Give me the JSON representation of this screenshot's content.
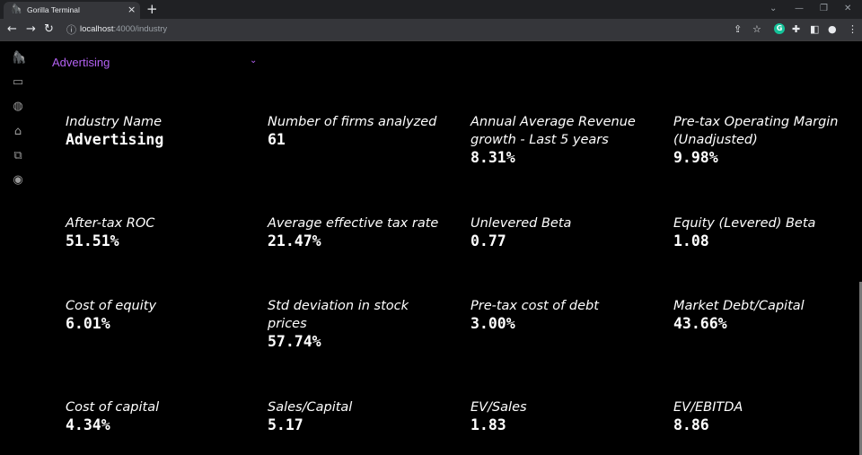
{
  "browser": {
    "tab_title": "Gorilla Terminal",
    "url_host": "localhost",
    "url_path": ":4000/industry"
  },
  "industry_select": {
    "value": "Advertising"
  },
  "metrics": [
    {
      "label": "Industry Name",
      "value": "Advertising"
    },
    {
      "label": "Number of firms analyzed",
      "value": "61"
    },
    {
      "label": "Annual Average Revenue growth - Last 5 years",
      "value": "8.31%"
    },
    {
      "label": "Pre-tax Operating Margin (Unadjusted)",
      "value": "9.98%"
    },
    {
      "label": "After-tax ROC",
      "value": "51.51%"
    },
    {
      "label": "Average effective tax rate",
      "value": "21.47%"
    },
    {
      "label": "Unlevered Beta",
      "value": "0.77"
    },
    {
      "label": "Equity (Levered) Beta",
      "value": "1.08"
    },
    {
      "label": "Cost of equity",
      "value": "6.01%"
    },
    {
      "label": "Std deviation in stock prices",
      "value": "57.74%"
    },
    {
      "label": "Pre-tax cost of debt",
      "value": "3.00%"
    },
    {
      "label": "Market Debt/Capital",
      "value": "43.66%"
    },
    {
      "label": "Cost of capital",
      "value": "4.34%"
    },
    {
      "label": "Sales/Capital",
      "value": "5.17"
    },
    {
      "label": "EV/Sales",
      "value": "1.83"
    },
    {
      "label": "EV/EBITDA",
      "value": "8.86"
    }
  ],
  "colors": {
    "accent": "#b361f2",
    "background": "#000000"
  },
  "icons": {
    "sidebar": [
      "gorilla-logo-icon",
      "box-icon",
      "globe-icon",
      "bank-icon",
      "cards-icon",
      "user-circle-icon"
    ]
  }
}
